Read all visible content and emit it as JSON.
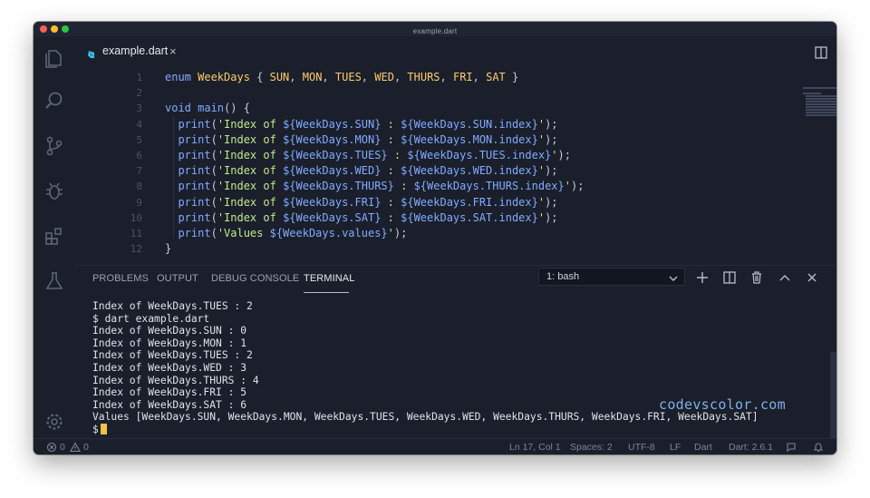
{
  "window": {
    "title": "example.dart"
  },
  "activity_bar": {
    "items": [
      "files-icon",
      "search-icon",
      "source-control-icon",
      "debug-icon",
      "extensions-icon",
      "flask-icon"
    ],
    "settings": "gear-icon"
  },
  "editor": {
    "tab_label": "example.dart",
    "tab_close": "×",
    "actions": [
      "split-editor-icon",
      "more-actions-icon"
    ],
    "lines": [
      {
        "n": "1",
        "parts": [
          [
            "kw2",
            "enum "
          ],
          [
            "typ",
            "WeekDays"
          ],
          [
            "punc",
            " { "
          ],
          [
            "typ",
            "SUN"
          ],
          [
            "punc",
            ", "
          ],
          [
            "typ",
            "MON"
          ],
          [
            "punc",
            ", "
          ],
          [
            "typ",
            "TUES"
          ],
          [
            "punc",
            ", "
          ],
          [
            "typ",
            "WED"
          ],
          [
            "punc",
            ", "
          ],
          [
            "typ",
            "THURS"
          ],
          [
            "punc",
            ", "
          ],
          [
            "typ",
            "FRI"
          ],
          [
            "punc",
            ", "
          ],
          [
            "typ",
            "SAT"
          ],
          [
            "punc",
            " }"
          ]
        ]
      },
      {
        "n": "2",
        "parts": []
      },
      {
        "n": "3",
        "parts": [
          [
            "kw2",
            "void "
          ],
          [
            "fn",
            "main"
          ],
          [
            "punc",
            "() {"
          ]
        ]
      },
      {
        "n": "4",
        "parts": [
          [
            "punc",
            "  "
          ],
          [
            "fn",
            "print"
          ],
          [
            "punc",
            "("
          ],
          [
            "str",
            "'Index of "
          ],
          [
            "interp",
            "${WeekDays.SUN}"
          ],
          [
            "str",
            " : "
          ],
          [
            "interp",
            "${WeekDays.SUN.index}"
          ],
          [
            "str",
            "'"
          ],
          [
            "punc",
            ");"
          ]
        ]
      },
      {
        "n": "5",
        "parts": [
          [
            "punc",
            "  "
          ],
          [
            "fn",
            "print"
          ],
          [
            "punc",
            "("
          ],
          [
            "str",
            "'Index of "
          ],
          [
            "interp",
            "${WeekDays.MON}"
          ],
          [
            "str",
            " : "
          ],
          [
            "interp",
            "${WeekDays.MON.index}"
          ],
          [
            "str",
            "'"
          ],
          [
            "punc",
            ");"
          ]
        ]
      },
      {
        "n": "6",
        "parts": [
          [
            "punc",
            "  "
          ],
          [
            "fn",
            "print"
          ],
          [
            "punc",
            "("
          ],
          [
            "str",
            "'Index of "
          ],
          [
            "interp",
            "${WeekDays.TUES}"
          ],
          [
            "str",
            " : "
          ],
          [
            "interp",
            "${WeekDays.TUES.index}"
          ],
          [
            "str",
            "'"
          ],
          [
            "punc",
            ");"
          ]
        ]
      },
      {
        "n": "7",
        "parts": [
          [
            "punc",
            "  "
          ],
          [
            "fn",
            "print"
          ],
          [
            "punc",
            "("
          ],
          [
            "str",
            "'Index of "
          ],
          [
            "interp",
            "${WeekDays.WED}"
          ],
          [
            "str",
            " : "
          ],
          [
            "interp",
            "${WeekDays.WED.index}"
          ],
          [
            "str",
            "'"
          ],
          [
            "punc",
            ");"
          ]
        ]
      },
      {
        "n": "8",
        "parts": [
          [
            "punc",
            "  "
          ],
          [
            "fn",
            "print"
          ],
          [
            "punc",
            "("
          ],
          [
            "str",
            "'Index of "
          ],
          [
            "interp",
            "${WeekDays.THURS}"
          ],
          [
            "str",
            " : "
          ],
          [
            "interp",
            "${WeekDays.THURS.index}"
          ],
          [
            "str",
            "'"
          ],
          [
            "punc",
            ");"
          ]
        ]
      },
      {
        "n": "9",
        "parts": [
          [
            "punc",
            "  "
          ],
          [
            "fn",
            "print"
          ],
          [
            "punc",
            "("
          ],
          [
            "str",
            "'Index of "
          ],
          [
            "interp",
            "${WeekDays.FRI}"
          ],
          [
            "str",
            " : "
          ],
          [
            "interp",
            "${WeekDays.FRI.index}"
          ],
          [
            "str",
            "'"
          ],
          [
            "punc",
            ");"
          ]
        ]
      },
      {
        "n": "10",
        "parts": [
          [
            "punc",
            "  "
          ],
          [
            "fn",
            "print"
          ],
          [
            "punc",
            "("
          ],
          [
            "str",
            "'Index of "
          ],
          [
            "interp",
            "${WeekDays.SAT}"
          ],
          [
            "str",
            " : "
          ],
          [
            "interp",
            "${WeekDays.SAT.index}"
          ],
          [
            "str",
            "'"
          ],
          [
            "punc",
            ");"
          ]
        ]
      },
      {
        "n": "11",
        "parts": [
          [
            "punc",
            "  "
          ],
          [
            "fn",
            "print"
          ],
          [
            "punc",
            "("
          ],
          [
            "str",
            "'Values "
          ],
          [
            "interp",
            "${WeekDays.values}"
          ],
          [
            "str",
            "'"
          ],
          [
            "punc",
            ");"
          ]
        ]
      },
      {
        "n": "12",
        "parts": [
          [
            "punc",
            "}"
          ]
        ]
      }
    ]
  },
  "panel": {
    "tabs": [
      "PROBLEMS",
      "OUTPUT",
      "DEBUG CONSOLE",
      "TERMINAL"
    ],
    "active_tab": "TERMINAL",
    "terminal_select": "1: bash",
    "actions": [
      "add-terminal-icon",
      "split-terminal-icon",
      "trash-icon",
      "maximize-panel-icon",
      "close-panel-icon"
    ],
    "terminal_lines": [
      "Index of WeekDays.TUES : 2",
      "$ dart example.dart",
      "Index of WeekDays.SUN : 0",
      "Index of WeekDays.MON : 1",
      "Index of WeekDays.TUES : 2",
      "Index of WeekDays.WED : 3",
      "Index of WeekDays.THURS : 4",
      "Index of WeekDays.FRI : 5",
      "Index of WeekDays.SAT : 6",
      "Values [WeekDays.SUN, WeekDays.MON, WeekDays.TUES, WeekDays.WED, WeekDays.THURS, WeekDays.FRI, WeekDays.SAT]"
    ],
    "prompt": "$"
  },
  "watermark": "codevscolor.com",
  "statusbar": {
    "errors": "0",
    "warnings": "0",
    "position": "Ln 17, Col 1",
    "spaces": "Spaces: 2",
    "encoding": "UTF-8",
    "eol": "LF",
    "language": "Dart",
    "sdk": "Dart: 2.6.1"
  },
  "colors": {
    "background": "#1a1f2b",
    "accent": "#e39b35",
    "cursor": "#f5c242"
  }
}
